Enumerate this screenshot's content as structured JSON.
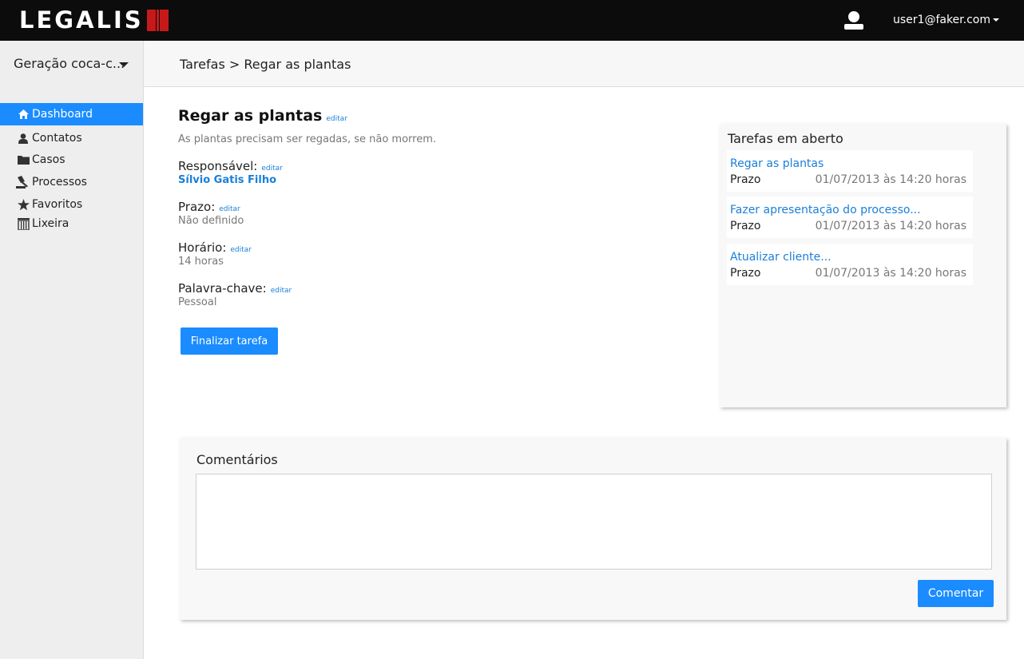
{
  "header": {
    "logo_text": "LEGALIS",
    "user_email": "user1@faker.com",
    "user_icon": "user-icon",
    "brand_color": "#c8191a"
  },
  "sidebar": {
    "project": "Geração coca-c...",
    "items": [
      {
        "label": "Dashboard",
        "icon": "home-icon",
        "active": true
      },
      {
        "label": "Contatos",
        "icon": "person-icon",
        "active": false
      },
      {
        "label": "Casos",
        "icon": "folder-icon",
        "active": false
      },
      {
        "label": "Processos",
        "icon": "gavel-icon",
        "active": false
      },
      {
        "label": "Favoritos",
        "icon": "star-icon",
        "active": false
      },
      {
        "label": "Lixeira",
        "icon": "trash-icon",
        "active": false
      }
    ]
  },
  "breadcrumb": "Tarefas > Regar as plantas",
  "task": {
    "title": "Regar as plantas",
    "edit_label": "editar",
    "description": "As plantas precisam ser regadas, se não morrem.",
    "fields": [
      {
        "label": "Responsável:",
        "value": "Sílvio Gatis Filho"
      },
      {
        "label": "Prazo:",
        "value": "Não definido"
      },
      {
        "label": "Horário:",
        "value": "14 horas"
      },
      {
        "label": "Palavra-chave:",
        "value": "Pessoal"
      }
    ],
    "finish_button": "Finalizar tarefa"
  },
  "open_tasks": {
    "title": "Tarefas em aberto",
    "items": [
      {
        "name": "Regar as plantas",
        "label": "Prazo",
        "date": "01/07/2013 às 14:20 horas"
      },
      {
        "name": "Fazer apresentação do processo...",
        "label": "Prazo",
        "date": "01/07/2013 às 14:20 horas"
      },
      {
        "name": "Atualizar cliente...",
        "label": "Prazo",
        "date": "01/07/2013 às 14:20 horas"
      }
    ]
  },
  "comments": {
    "title": "Comentários",
    "input_value": "",
    "submit_button": "Comentar"
  },
  "colors": {
    "accent": "#1a8cff",
    "link": "#1a7fd9",
    "topbar": "#0c0c0c"
  }
}
